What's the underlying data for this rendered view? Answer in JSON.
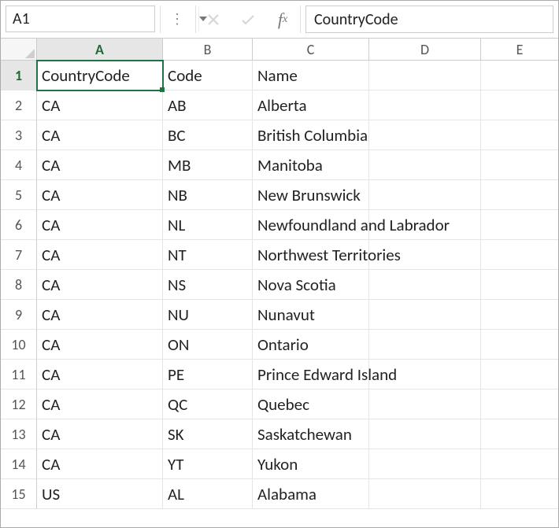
{
  "formula_bar": {
    "name_box": "A1",
    "formula_value": "CountryCode"
  },
  "columns": [
    "A",
    "B",
    "C",
    "D",
    "E"
  ],
  "active_col": "A",
  "active_row": 1,
  "selected_cell": "A1",
  "rows": [
    {
      "n": 1,
      "A": "CountryCode",
      "B": "Code",
      "C": "Name",
      "D": "",
      "E": ""
    },
    {
      "n": 2,
      "A": "CA",
      "B": "AB",
      "C": "Alberta",
      "D": "",
      "E": ""
    },
    {
      "n": 3,
      "A": "CA",
      "B": "BC",
      "C": "British Columbia",
      "D": "",
      "E": ""
    },
    {
      "n": 4,
      "A": "CA",
      "B": "MB",
      "C": "Manitoba",
      "D": "",
      "E": ""
    },
    {
      "n": 5,
      "A": "CA",
      "B": "NB",
      "C": "New Brunswick",
      "D": "",
      "E": ""
    },
    {
      "n": 6,
      "A": "CA",
      "B": "NL",
      "C": "Newfoundland and Labrador",
      "D": "",
      "E": ""
    },
    {
      "n": 7,
      "A": "CA",
      "B": "NT",
      "C": "Northwest Territories",
      "D": "",
      "E": ""
    },
    {
      "n": 8,
      "A": "CA",
      "B": "NS",
      "C": "Nova Scotia",
      "D": "",
      "E": ""
    },
    {
      "n": 9,
      "A": "CA",
      "B": "NU",
      "C": "Nunavut",
      "D": "",
      "E": ""
    },
    {
      "n": 10,
      "A": "CA",
      "B": "ON",
      "C": "Ontario",
      "D": "",
      "E": ""
    },
    {
      "n": 11,
      "A": "CA",
      "B": "PE",
      "C": "Prince Edward Island",
      "D": "",
      "E": ""
    },
    {
      "n": 12,
      "A": "CA",
      "B": "QC",
      "C": "Quebec",
      "D": "",
      "E": ""
    },
    {
      "n": 13,
      "A": "CA",
      "B": "SK",
      "C": "Saskatchewan",
      "D": "",
      "E": ""
    },
    {
      "n": 14,
      "A": "CA",
      "B": "YT",
      "C": "Yukon",
      "D": "",
      "E": ""
    },
    {
      "n": 15,
      "A": "US",
      "B": "AL",
      "C": "Alabama",
      "D": "",
      "E": ""
    }
  ]
}
